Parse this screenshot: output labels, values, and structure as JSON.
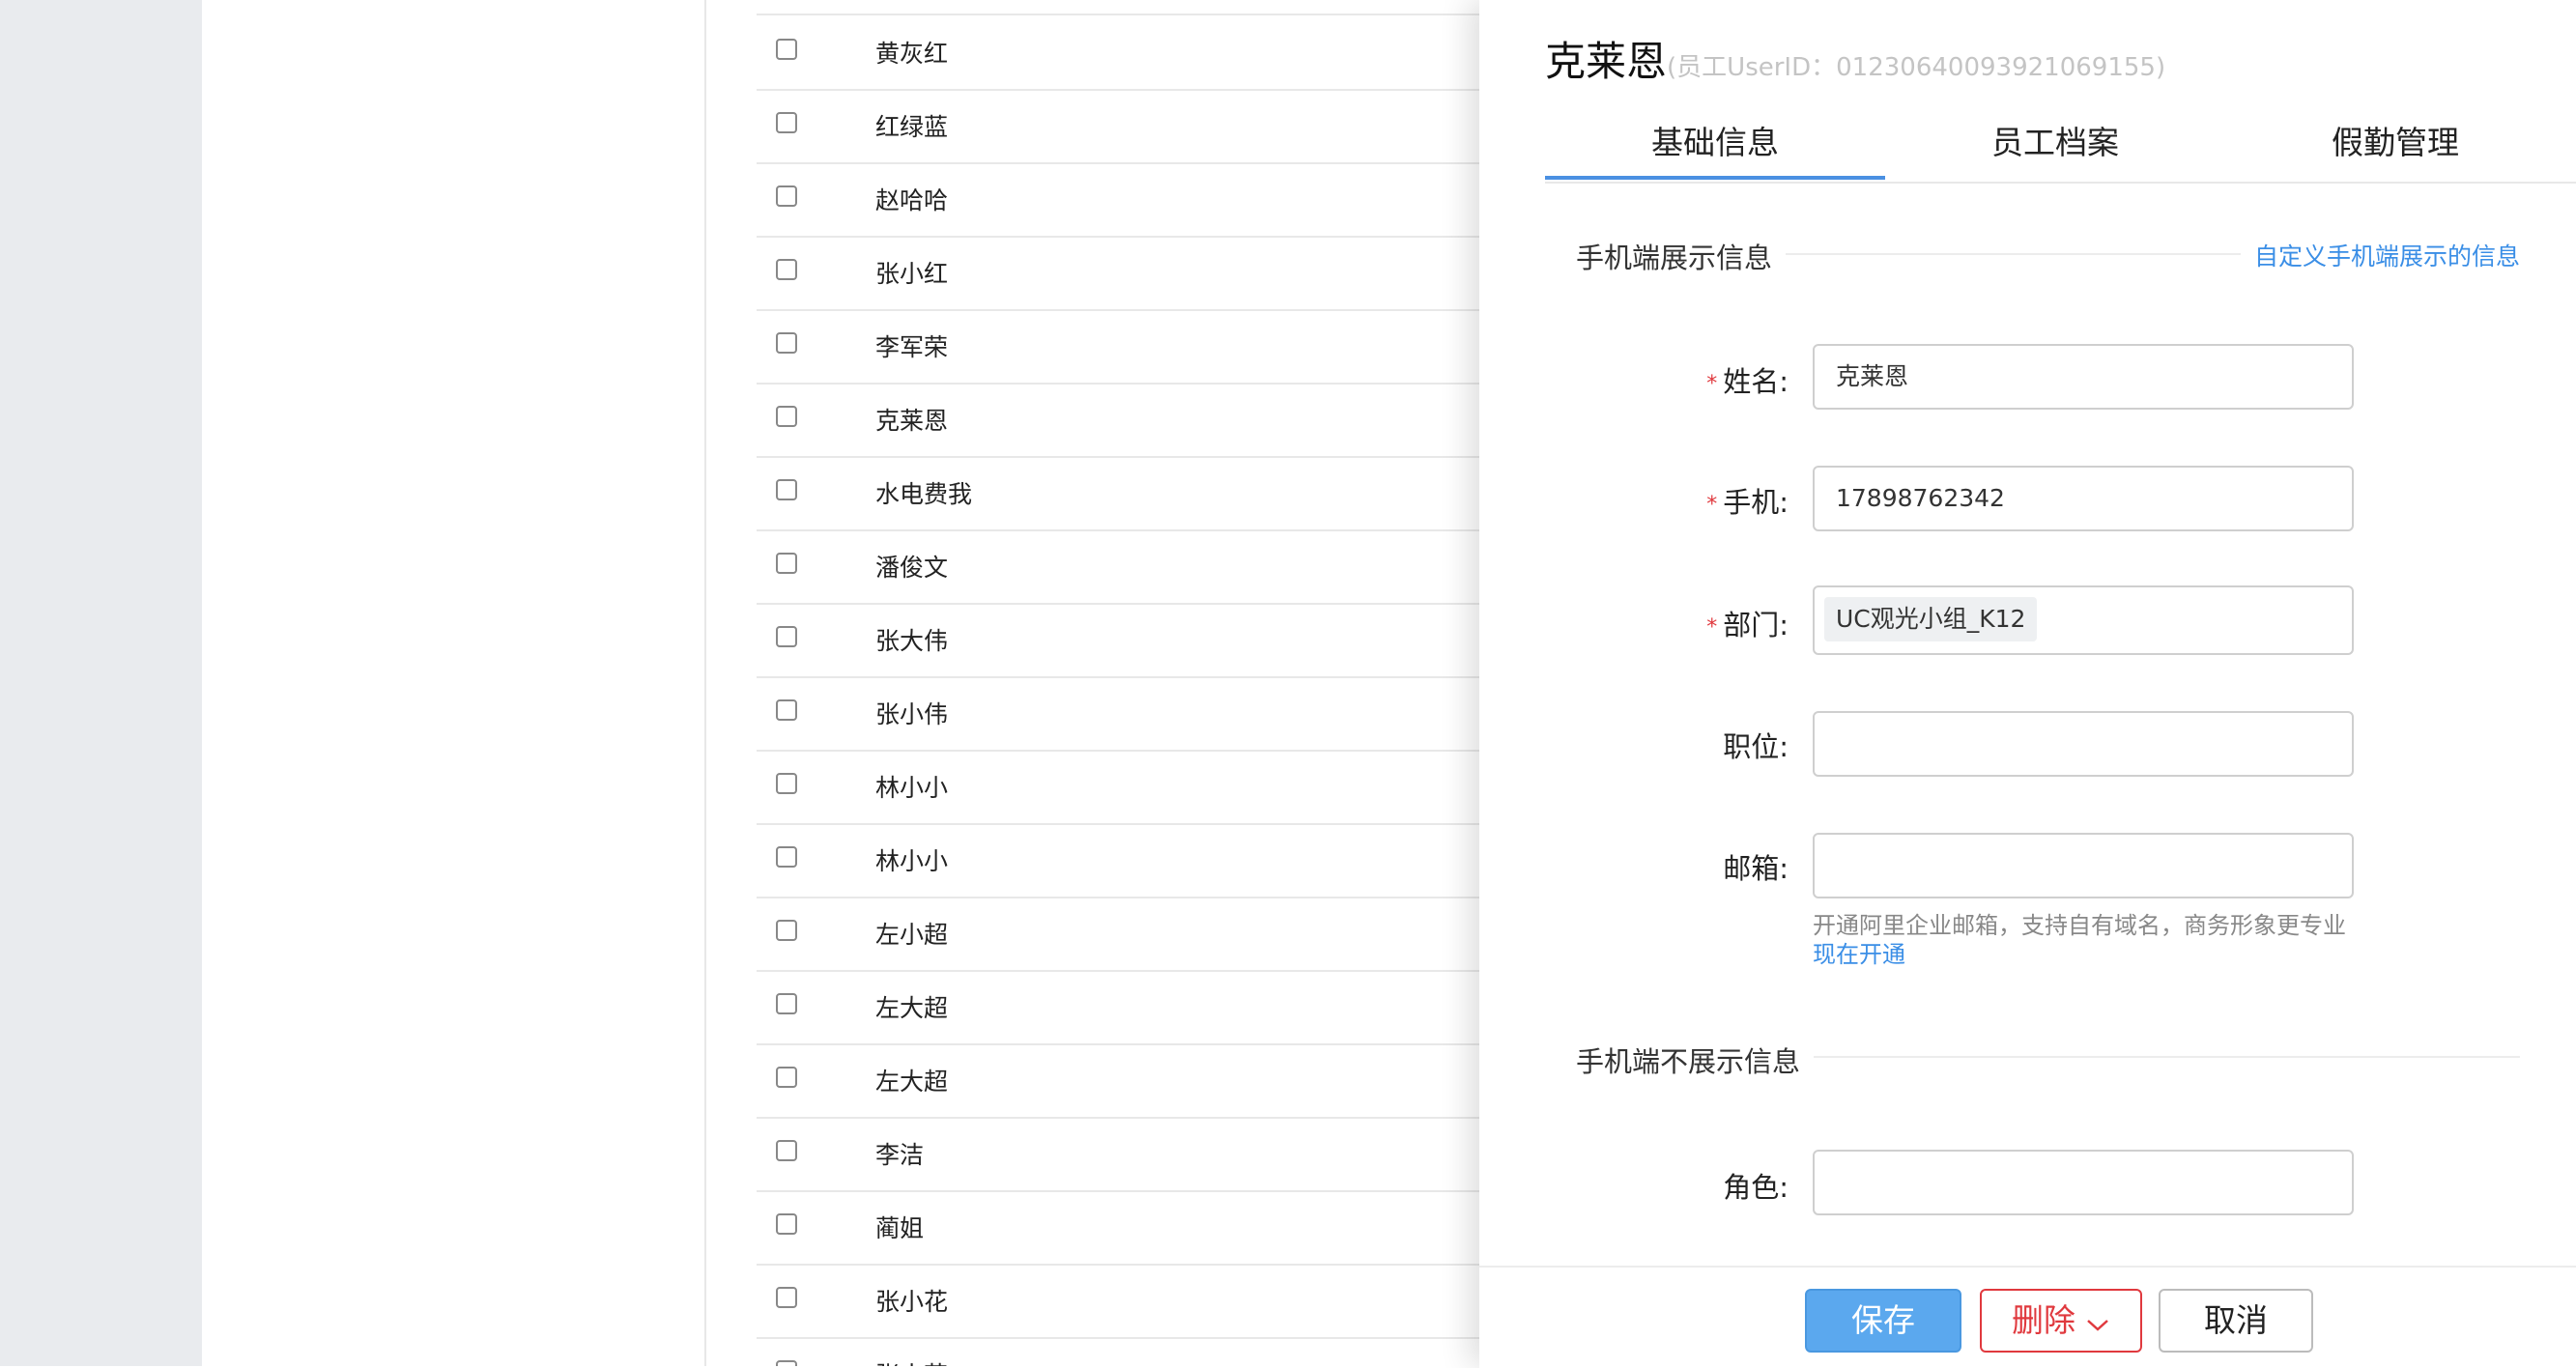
{
  "employee_list": [
    {
      "name": "黄灰红"
    },
    {
      "name": "红绿蓝"
    },
    {
      "name": "赵哈哈"
    },
    {
      "name": "张小红"
    },
    {
      "name": "李军荣"
    },
    {
      "name": "克莱恩"
    },
    {
      "name": "水电费我"
    },
    {
      "name": "潘俊文"
    },
    {
      "name": "张大伟"
    },
    {
      "name": "张小伟"
    },
    {
      "name": "林小小"
    },
    {
      "name": "林小小"
    },
    {
      "name": "左小超"
    },
    {
      "name": "左大超"
    },
    {
      "name": "左大超"
    },
    {
      "name": "李洁"
    },
    {
      "name": "蔺姐"
    },
    {
      "name": "张小花"
    },
    {
      "name": "张小花"
    }
  ],
  "drawer": {
    "name": "克莱恩",
    "user_id_text": "(员工UserID：0123064009392106915​5)",
    "tabs": [
      {
        "label": "基础信息"
      },
      {
        "label": "员工档案"
      },
      {
        "label": "假勤管理"
      }
    ],
    "section_mobile_shown": "手机端展示信息",
    "custom_link": "自定义手机端展示的信息",
    "fields": {
      "name_label": "姓名:",
      "name_value": "克莱恩",
      "phone_label": "手机:",
      "phone_value": "17898762342",
      "dept_label": "部门:",
      "dept_tag": "UC观光小组_K12",
      "position_label": "职位:",
      "position_value": "",
      "email_label": "邮箱:",
      "email_value": "",
      "role_label": "角色:",
      "role_value": ""
    },
    "required_mark": "*",
    "email_hint": "开通阿里企业邮箱，支持自有域名，商务形象更专业",
    "email_link": "现在开通",
    "section_mobile_hidden": "手机端不展示信息",
    "buttons": {
      "save": "保存",
      "delete": "删除",
      "cancel": "取消"
    }
  }
}
